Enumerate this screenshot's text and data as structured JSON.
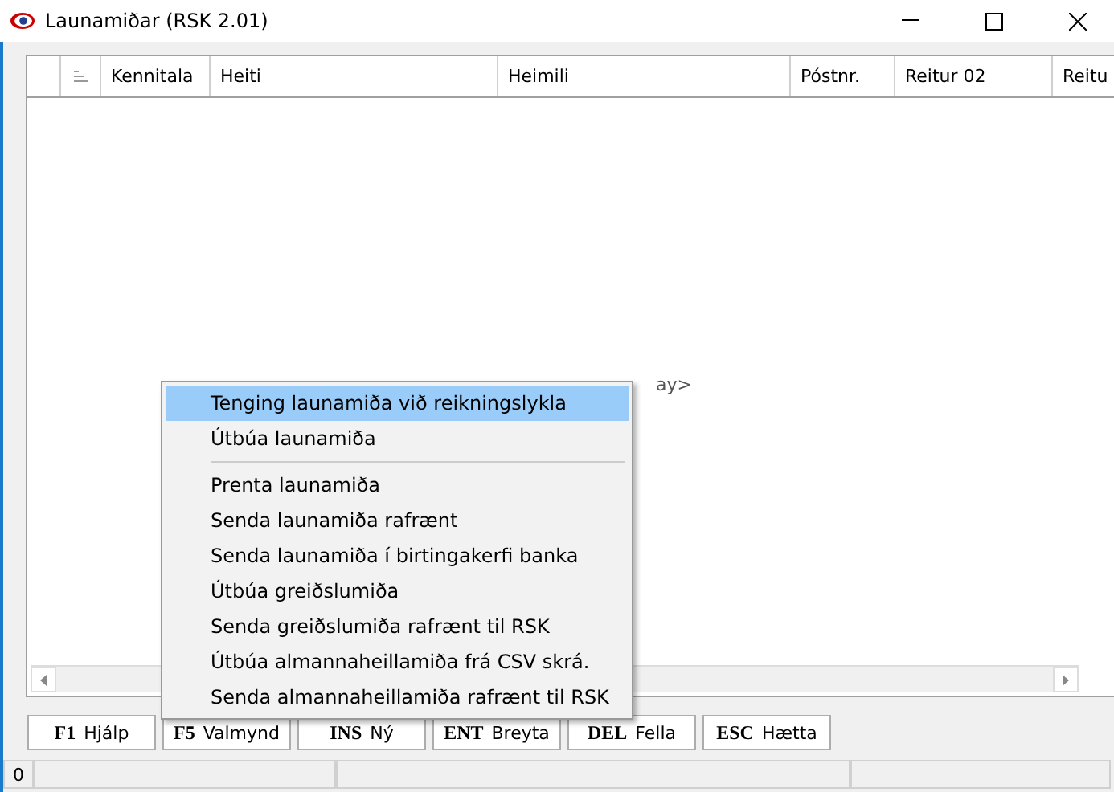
{
  "window": {
    "title": "Launamiðar (RSK 2.01)"
  },
  "table": {
    "columns": [
      "Kennitala",
      "Heiti",
      "Heimili",
      "Póstnr.",
      "Reitur 02",
      "Reitu"
    ],
    "empty_text": "ay>"
  },
  "context_menu": {
    "items": [
      {
        "kind": "item",
        "label": "Tenging launamiða við reikningslykla",
        "selected": true
      },
      {
        "kind": "item",
        "label": "Útbúa launamiða",
        "selected": false
      },
      {
        "kind": "separator"
      },
      {
        "kind": "item",
        "label": "Prenta launamiða",
        "selected": false
      },
      {
        "kind": "item",
        "label": "Senda launamiða rafrænt",
        "selected": false
      },
      {
        "kind": "item",
        "label": "Senda launamiða í birtingakerfi banka",
        "selected": false
      },
      {
        "kind": "item",
        "label": "Útbúa greiðslumiða",
        "selected": false
      },
      {
        "kind": "item",
        "label": "Senda greiðslumiða rafrænt til RSK",
        "selected": false
      },
      {
        "kind": "item",
        "label": "Útbúa almannaheillamiða frá CSV skrá.",
        "selected": false
      },
      {
        "kind": "item",
        "label": "Senda almannaheillamiða rafrænt til RSK",
        "selected": false
      }
    ]
  },
  "buttons": [
    {
      "key": "F1",
      "label": "Hjálp"
    },
    {
      "key": "F5",
      "label": "Valmynd"
    },
    {
      "key": "INS",
      "label": "Ný"
    },
    {
      "key": "ENT",
      "label": "Breyta"
    },
    {
      "key": "DEL",
      "label": "Fella"
    },
    {
      "key": "ESC",
      "label": "Hætta"
    }
  ],
  "status_bar": [
    "0"
  ]
}
